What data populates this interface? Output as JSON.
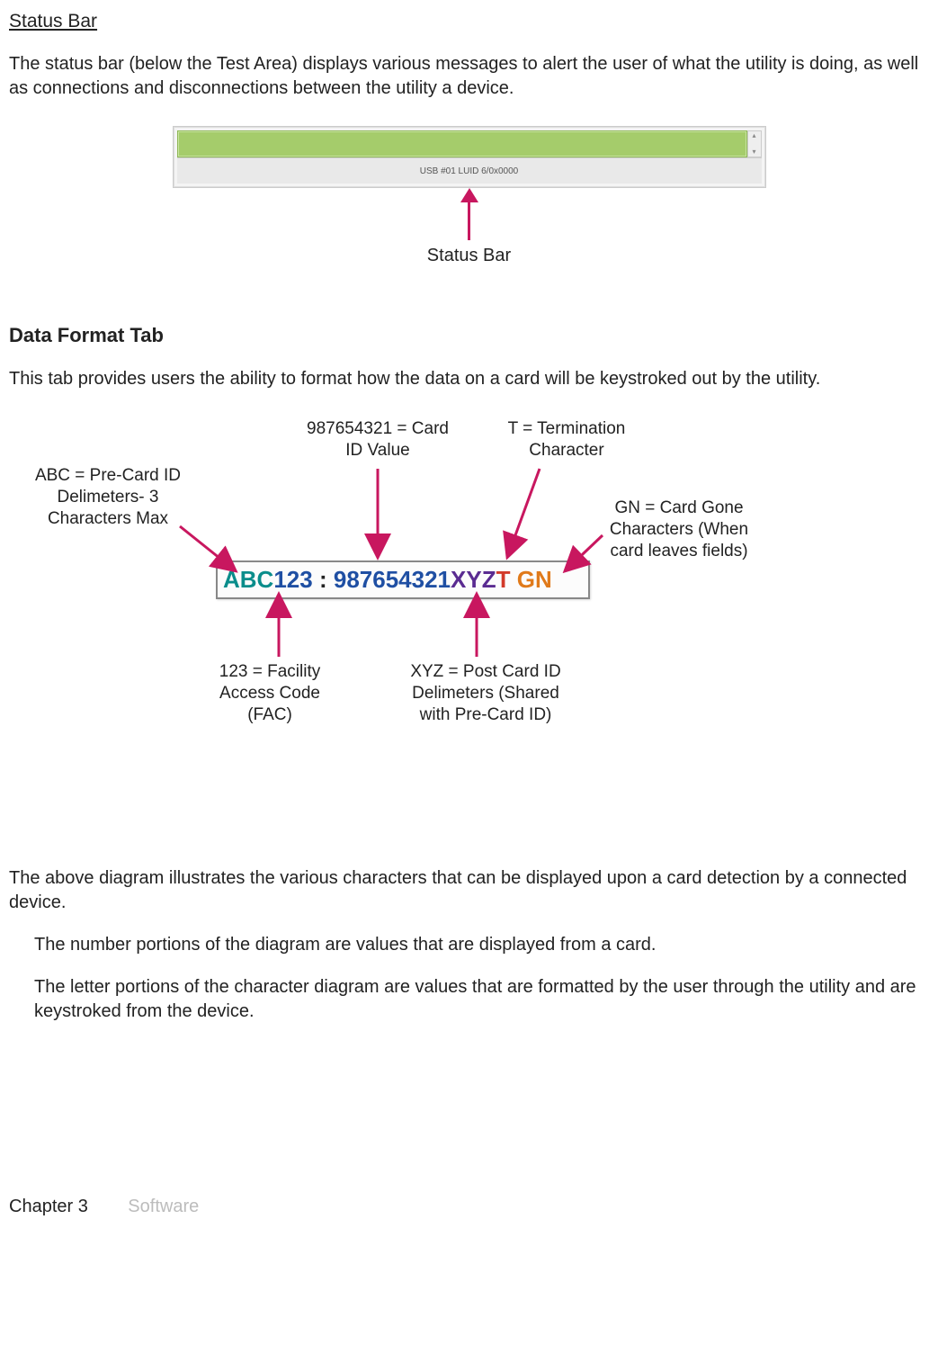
{
  "section1": {
    "title": "Status Bar",
    "desc": "The status bar (below the Test Area) displays various messages to alert the user of what the utility is doing, as well as connections and disconnections between the utility a device.",
    "strip_text": "USB #01 LUID 6/0x0000",
    "caption": "Status Bar"
  },
  "section2": {
    "title": "Data Format Tab",
    "desc": "This tab provides users the ability to format how the data on a card will be keystroked out by the utility.",
    "code": {
      "abc": "ABC",
      "fac": "123",
      "sep": ":",
      "card": "987654321",
      "xyz": "XYZ",
      "t": "T",
      "gn": "GN"
    },
    "ann": {
      "abc": "ABC = Pre-Card ID Delimeters- 3 Characters Max",
      "card": "987654321 = Card ID Value",
      "t": "T = Termination Character",
      "gn": "GN = Card Gone Characters (When card leaves fields)",
      "fac": "123 = Facility Access Code (FAC)",
      "xyz": "XYZ = Post Card ID Delimeters (Shared with Pre-Card ID)"
    },
    "after1": "The above diagram illustrates the various characters that can be displayed upon a card detection by a connected device.",
    "after2": "The number portions of the diagram are values that are displayed from a card.",
    "after3": "The letter portions of the character diagram are values that are formatted by the user through the utility and are keystroked from the device."
  },
  "footer": {
    "chapter": "Chapter 3",
    "section": "Software"
  }
}
